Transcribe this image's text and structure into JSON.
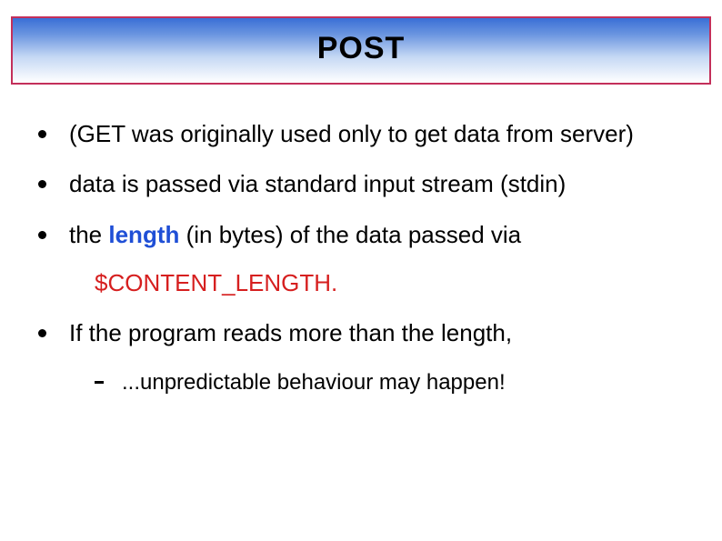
{
  "title": "POST",
  "bullets": [
    {
      "text": "(GET was originally used only to get data from server)"
    },
    {
      "text": "data is passed via standard input stream (stdin)"
    },
    {
      "prefix": "the ",
      "length_word": "length",
      "suffix": " (in bytes) of the data passed via",
      "code": "$CONTENT_LENGTH."
    },
    {
      "text": "If the program reads more than the length,",
      "sub": [
        "...unpredictable behaviour may happen!"
      ]
    }
  ]
}
